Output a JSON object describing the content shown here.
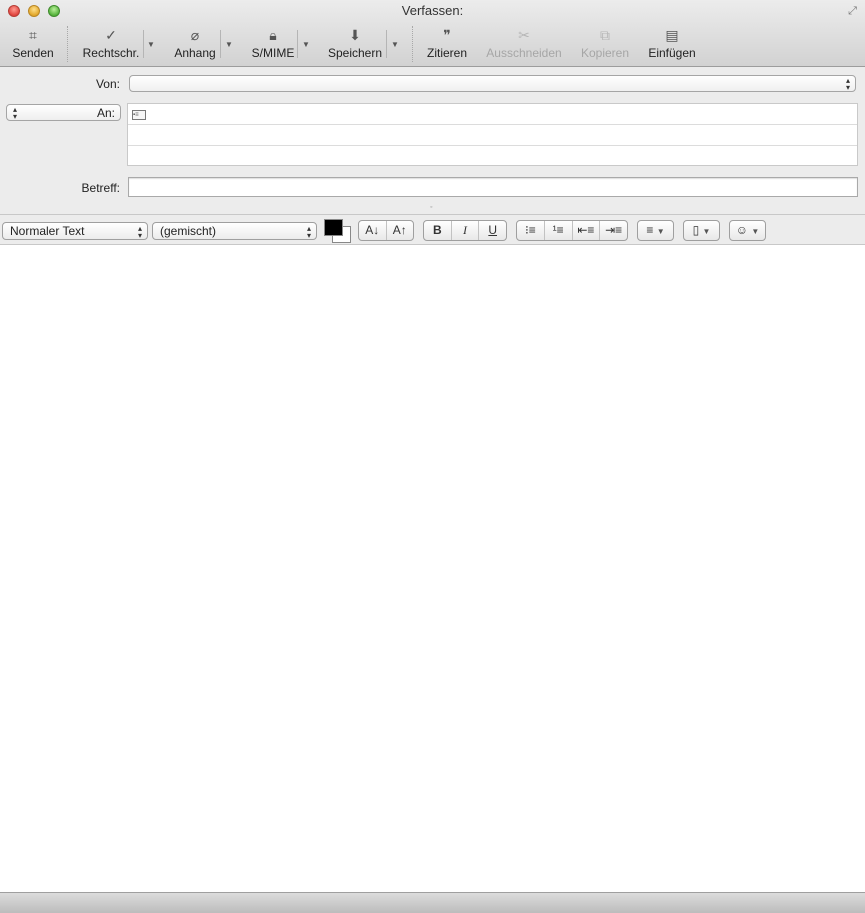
{
  "window": {
    "title": "Verfassen:"
  },
  "toolbar": {
    "send_label": "Senden",
    "spelling_label": "Rechtschr.",
    "attachment_label": "Anhang",
    "smime_label": "S/MIME",
    "save_label": "Speichern",
    "quote_label": "Zitieren",
    "cut_label": "Ausschneiden",
    "copy_label": "Kopieren",
    "paste_label": "Einfügen"
  },
  "header": {
    "from_label": "Von:",
    "to_label": "An:",
    "subject_label": "Betreff:",
    "from_value": "",
    "subject_value": ""
  },
  "format": {
    "paragraph_style": "Normaler Text",
    "font": "(gemischt)",
    "text_color": "#000000",
    "background_color": "#ffffff",
    "bold": "B",
    "italic": "I",
    "underline": "U"
  }
}
